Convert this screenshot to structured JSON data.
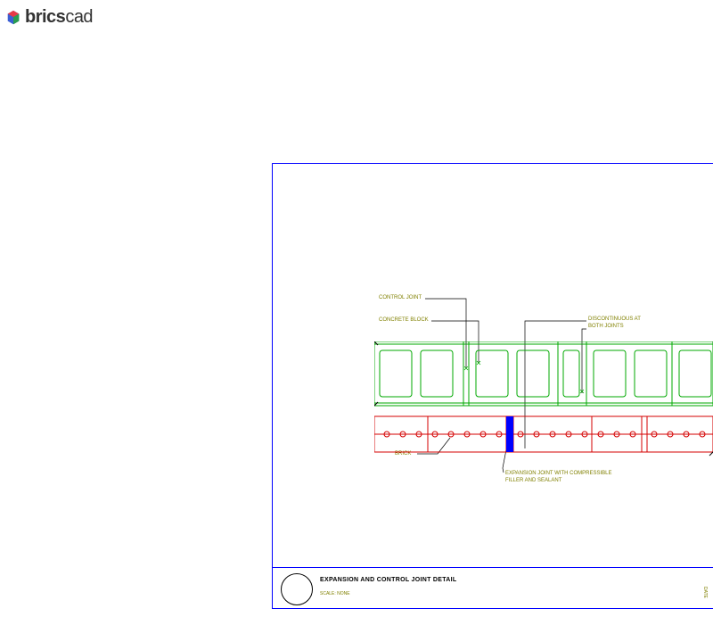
{
  "app": {
    "name_bold": "brics",
    "name_light": "cad"
  },
  "labels": {
    "control_joint": "CONTROL JOINT",
    "concrete_block": "CONCRETE BLOCK",
    "discontinuous": "DISCONTINUOUS AT\nBOTH JOINTS",
    "brick": "BRICK",
    "expansion_joint": "EXPANSION JOINT WITH COMPRESSIBLE\nFILLER AND SEALANT"
  },
  "title_block": {
    "title": "EXPANSION AND CONTROL JOINT DETAIL",
    "scale": "SCALE: NONE"
  },
  "side": "DATE"
}
